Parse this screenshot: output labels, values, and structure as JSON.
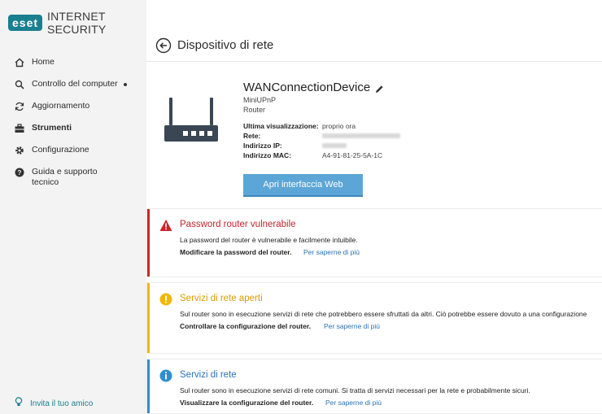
{
  "app": {
    "logo": "eset",
    "product": "INTERNET SECURITY"
  },
  "sidebar": {
    "items": [
      {
        "label": "Home",
        "icon": "home-icon"
      },
      {
        "label": "Controllo del computer",
        "icon": "search-icon"
      },
      {
        "label": "Aggiornamento",
        "icon": "refresh-icon"
      },
      {
        "label": "Strumenti",
        "icon": "toolbox-icon"
      },
      {
        "label": "Configurazione",
        "icon": "gear-icon"
      },
      {
        "label": "Guida e supporto tecnico",
        "icon": "help-icon"
      }
    ],
    "invite_label": "Invita il tuo amico"
  },
  "header": {
    "title": "Dispositivo di rete"
  },
  "device": {
    "name": "WANConnectionDevice",
    "model": "MiniUPnP",
    "type": "Router",
    "info": [
      {
        "key": "Ultima visualizzazione:",
        "value": "proprio ora"
      },
      {
        "key": "Rete:",
        "value": ""
      },
      {
        "key": "Indirizzo IP:",
        "value": ""
      },
      {
        "key": "Indirizzo MAC:",
        "value": "A4-91-81-25-5A-1C"
      }
    ],
    "web_button_label": "Apri interfaccia Web"
  },
  "alerts": [
    {
      "title": "Password router vulnerabile",
      "description": "La password del router è vulnerabile e facilmente intuibile.",
      "action": "Modificare la password del router.",
      "link": "Per saperne di più",
      "severity_color": "#d0242b"
    },
    {
      "title": "Servizi di rete aperti",
      "description": "Sul router sono in esecuzione servizi di rete che potrebbero essere sfruttati da altri. Ciò potrebbe essere dovuto a una configurazione",
      "action": "Controllare la configurazione del router.",
      "link": "Per saperne di più",
      "severity_color": "#f2b705"
    },
    {
      "title": "Servizi di rete",
      "description": "Sul router sono in esecuzione servizi di rete comuni. Si tratta di servizi necessari per la rete e probabilmente sicuri.",
      "action": "Visualizzare la configurazione del router.",
      "link": "Per saperne di più",
      "severity_color": "#2d8fd1"
    }
  ],
  "colors": {
    "brand": "#1a7f8e",
    "button": "#5ba6d6",
    "link": "#2a72b5"
  }
}
